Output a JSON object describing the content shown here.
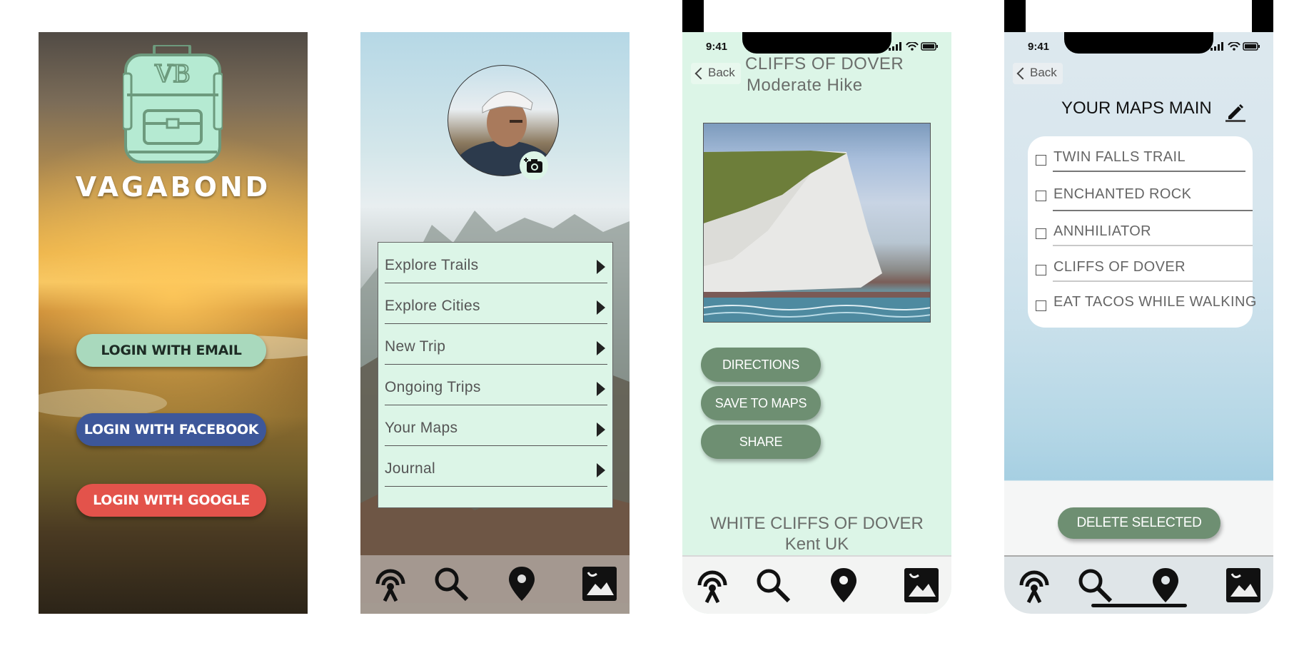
{
  "screen1": {
    "logo_monogram": "VB",
    "brand": "VAGABOND",
    "buttons": {
      "email": "LOGIN WITH EMAIL",
      "facebook": "LOGIN WITH FACEBOOK",
      "google": "LOGIN WITH GOOGLE"
    },
    "colors": {
      "email": "#a9d9bd",
      "facebook": "#3d579a",
      "google": "#e3534b",
      "logo": "#b5ead2"
    }
  },
  "screen2": {
    "menu": [
      {
        "label": "Explore Trails"
      },
      {
        "label": "Explore Cities"
      },
      {
        "label": "New Trip"
      },
      {
        "label": "Ongoing Trips"
      },
      {
        "label": "Your Maps"
      },
      {
        "label": "Journal"
      }
    ],
    "icons": [
      "camera-icon",
      "tracker-icon",
      "search-icon",
      "location-pin-icon",
      "gallery-icon"
    ]
  },
  "screen3": {
    "time": "9:41",
    "back": "Back",
    "title": "CLIFFS OF DOVER",
    "subtitle": "Moderate Hike",
    "buttons": {
      "directions": "DIRECTIONS",
      "save": "SAVE TO MAPS",
      "share": "SHARE"
    },
    "caption_title": "WHITE CLIFFS OF DOVER",
    "caption_location": "Kent UK",
    "colors": {
      "background": "#dcf5e7",
      "button": "#6e8f72"
    }
  },
  "screen4": {
    "time": "9:41",
    "back": "Back",
    "heading": "YOUR MAPS MAIN",
    "items": [
      {
        "label": "TWIN FALLS TRAIL",
        "checked": false
      },
      {
        "label": "ENCHANTED ROCK",
        "checked": false
      },
      {
        "label": "ANNHILIATOR",
        "checked": false
      },
      {
        "label": "CLIFFS OF DOVER",
        "checked": false
      },
      {
        "label": "EAT TACOS WHILE WALKING",
        "checked": false
      }
    ],
    "delete_button": "DELETE SELECTED"
  }
}
